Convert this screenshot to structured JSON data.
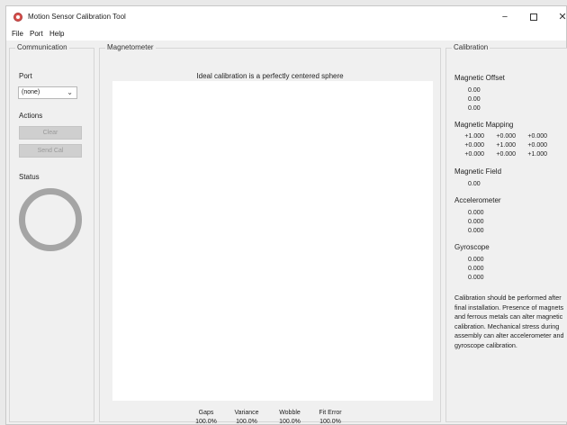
{
  "window": {
    "title": "Motion Sensor Calibration Tool",
    "controls": {
      "minimize": "−",
      "close": "✕"
    }
  },
  "menu": [
    "File",
    "Port",
    "Help"
  ],
  "communication": {
    "group_label": "Communication",
    "port_label": "Port",
    "port_value": "(none)",
    "actions_label": "Actions",
    "clear_label": "Clear",
    "send_cal_label": "Send Cal",
    "status_label": "Status"
  },
  "magnetometer": {
    "group_label": "Magnetometer",
    "plot_title": "Ideal calibration is a perfectly centered sphere",
    "metrics": [
      {
        "label": "Gaps",
        "value": "100.0%"
      },
      {
        "label": "Variance",
        "value": "100.0%"
      },
      {
        "label": "Wobble",
        "value": "100.0%"
      },
      {
        "label": "Fit Error",
        "value": "100.0%"
      }
    ]
  },
  "calibration": {
    "group_label": "Calibration",
    "offset_label": "Magnetic Offset",
    "offset_values": [
      "0.00",
      "0.00",
      "0.00"
    ],
    "mapping_label": "Magnetic Mapping",
    "mapping": [
      [
        "+1.000",
        "+0.000",
        "+0.000"
      ],
      [
        "+0.000",
        "+1.000",
        "+0.000"
      ],
      [
        "+0.000",
        "+0.000",
        "+1.000"
      ]
    ],
    "field_label": "Magnetic Field",
    "field_value": "0.00",
    "accel_label": "Accelerometer",
    "accel_values": [
      "0.000",
      "0.000",
      "0.000"
    ],
    "gyro_label": "Gyroscope",
    "gyro_values": [
      "0.000",
      "0.000",
      "0.000"
    ],
    "note": "Calibration should be performed after final installation.  Presence of magnets and ferrous metals can alter magnetic calibration. Mechanical stress during assembly can alter accelerometer and gyroscope calibration."
  }
}
